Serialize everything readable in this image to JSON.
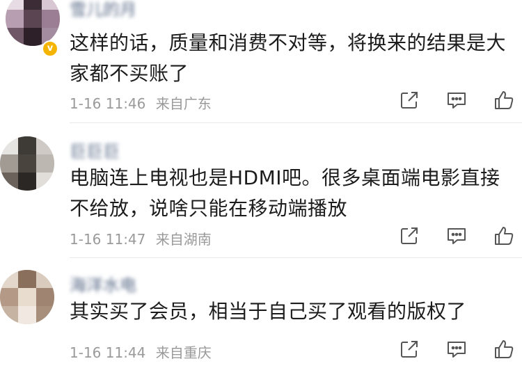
{
  "comments": [
    {
      "username": "雪儿的月",
      "text": "这样的话，质量和消费不对等，将换来的结果是大家都不买账了",
      "time": "1-16 11:46",
      "location": "来自广东"
    },
    {
      "username": "巨巨巨",
      "text": "电脑连上电视也是HDMI吧。很多桌面端电影直接不给放，说啥只能在移动端播放",
      "time": "1-16 11:47",
      "location": "来自湖南"
    },
    {
      "username": "海洋水电",
      "text": "其实买了会员，相当于自己买了观看的版权了",
      "time": "1-16 11:44",
      "location": "来自重庆"
    }
  ],
  "icons": {
    "share": "share-icon",
    "reply": "comment-icon",
    "like": "thumbs-up-icon"
  },
  "colors": {
    "meta": "#9a9a9a",
    "icon": "#555555",
    "divider": "#e8e8e8"
  }
}
